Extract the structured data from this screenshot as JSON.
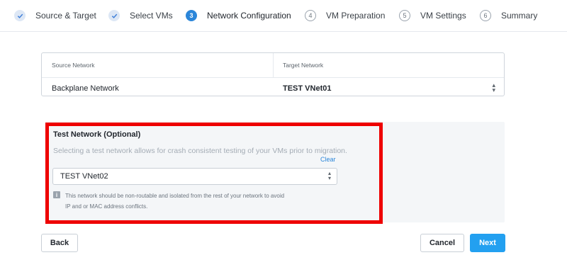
{
  "steps": [
    {
      "number": "",
      "label": "Source & Target",
      "state": "done"
    },
    {
      "number": "",
      "label": "Select VMs",
      "state": "done"
    },
    {
      "number": "3",
      "label": "Network Configuration",
      "state": "active"
    },
    {
      "number": "4",
      "label": "VM Preparation",
      "state": "todo"
    },
    {
      "number": "5",
      "label": "VM Settings",
      "state": "todo"
    },
    {
      "number": "6",
      "label": "Summary",
      "state": "todo"
    }
  ],
  "mapping": {
    "source_header": "Source Network",
    "target_header": "Target Network",
    "source_value": "Backplane Network",
    "target_value": "TEST VNet01"
  },
  "test_network": {
    "title": "Test Network (Optional)",
    "description": "Selecting a test network allows for crash consistent testing of your VMs prior to migration.",
    "clear_label": "Clear",
    "selected_value": "TEST VNet02",
    "info_line1": "This network should be non-routable and isolated from the rest of your network to avoid",
    "info_line2": "IP and or MAC address conflicts."
  },
  "footer": {
    "back_label": "Back",
    "cancel_label": "Cancel",
    "next_label": "Next"
  },
  "colors": {
    "accent": "#2b86d9",
    "primary_button": "#23a0f0",
    "highlight": "#ee0000"
  }
}
